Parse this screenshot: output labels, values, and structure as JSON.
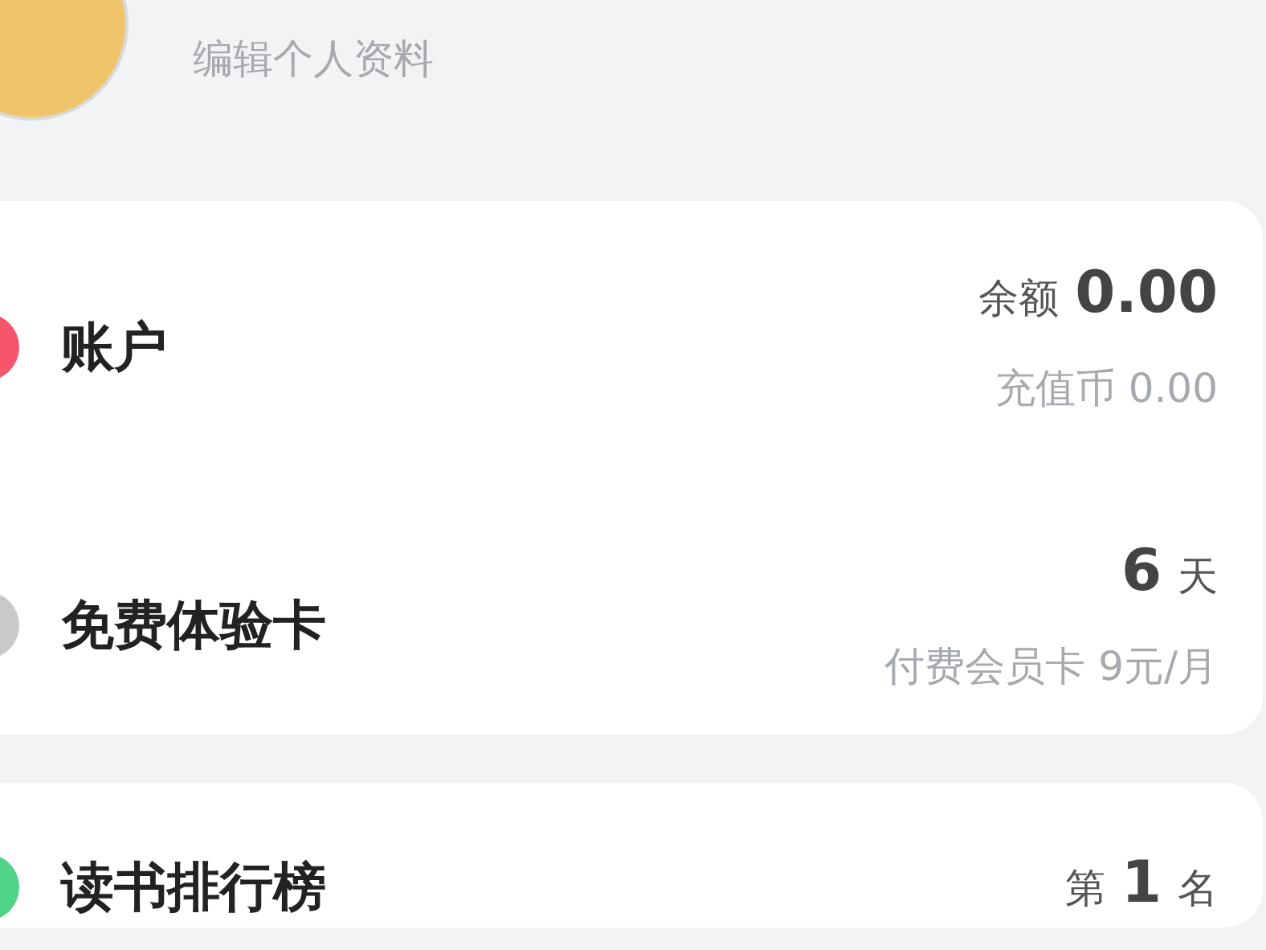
{
  "profile": {
    "edit_link": "编辑个人资料"
  },
  "cards": [
    {
      "rows": [
        {
          "title": "账户",
          "color": "#f5566b",
          "main": {
            "prefix": "余额",
            "value": "0.00"
          },
          "sub": "充值币 0.00"
        },
        {
          "title": "免费体验卡",
          "color": "#c9c9c9",
          "main": {
            "value": "6",
            "suffix": "天"
          },
          "sub": "付费会员卡 9元/月"
        }
      ]
    },
    {
      "rows": [
        {
          "title": "读书排行榜",
          "color": "#4fd487",
          "main": {
            "prefix": "第",
            "value": "1",
            "suffix": "名"
          }
        }
      ]
    }
  ]
}
